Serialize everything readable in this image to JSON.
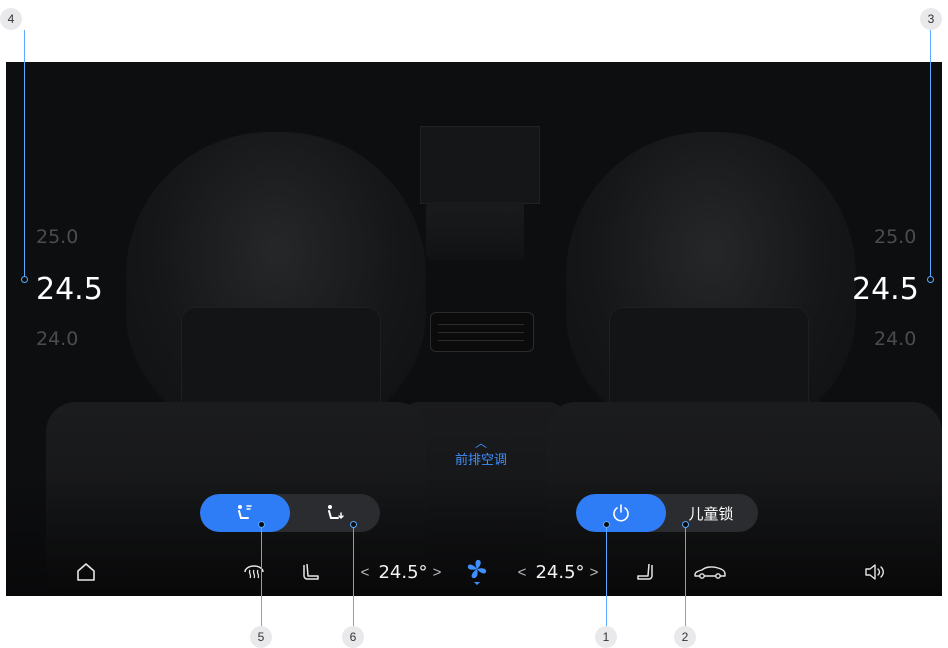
{
  "callouts": [
    "1",
    "2",
    "3",
    "4",
    "5",
    "6"
  ],
  "left_temps": {
    "upper": "25.0",
    "current": "24.5",
    "lower": "24.0"
  },
  "right_temps": {
    "upper": "25.0",
    "current": "24.5",
    "lower": "24.0"
  },
  "front_ac": {
    "label": "前排空调"
  },
  "power_lock": {
    "lock_label": "儿童锁"
  },
  "bottom_bar": {
    "left_temp": "24.5°",
    "right_temp": "24.5°",
    "left_arrow_prev": "<",
    "left_arrow_next": ">",
    "right_arrow_prev": "<",
    "right_arrow_next": ">"
  },
  "colors": {
    "accent": "#2f7df6",
    "callout_line": "#5aa9ff",
    "background": "#0d0e10"
  },
  "icons": [
    "home-icon",
    "rear-defrost-icon",
    "seat-heat-icon",
    "fan-icon",
    "seat-ventilation-icon",
    "car-icon",
    "volume-icon",
    "power-icon",
    "airflow-face-icon",
    "airflow-feet-icon"
  ]
}
